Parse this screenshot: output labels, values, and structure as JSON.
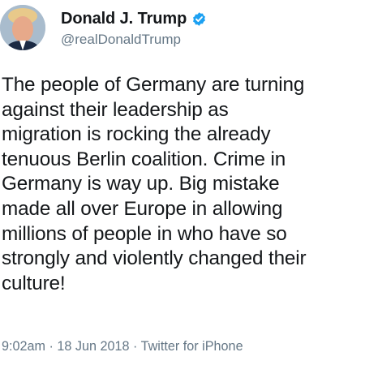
{
  "tweet": {
    "display_name": "Donald J. Trump",
    "handle": "@realDonaldTrump",
    "verified": true,
    "text": "The people of Germany are turning\nagainst their leadership as\nmigration is rocking the already\ntenuous Berlin coalition. Crime in\nGermany is way up. Big mistake\nmade all over Europe in allowing\nmillions of people in who have so\nstrongly and violently changed their\nculture!",
    "time": "9:02am",
    "date": "18 Jun 2018",
    "source": "Twitter for iPhone",
    "separator": " · "
  },
  "colors": {
    "verified_blue": "#1da1f2",
    "text": "#14171a",
    "secondary_text": "#657786"
  },
  "icons": {
    "verified": "verified-badge-icon",
    "avatar": "profile-avatar"
  }
}
